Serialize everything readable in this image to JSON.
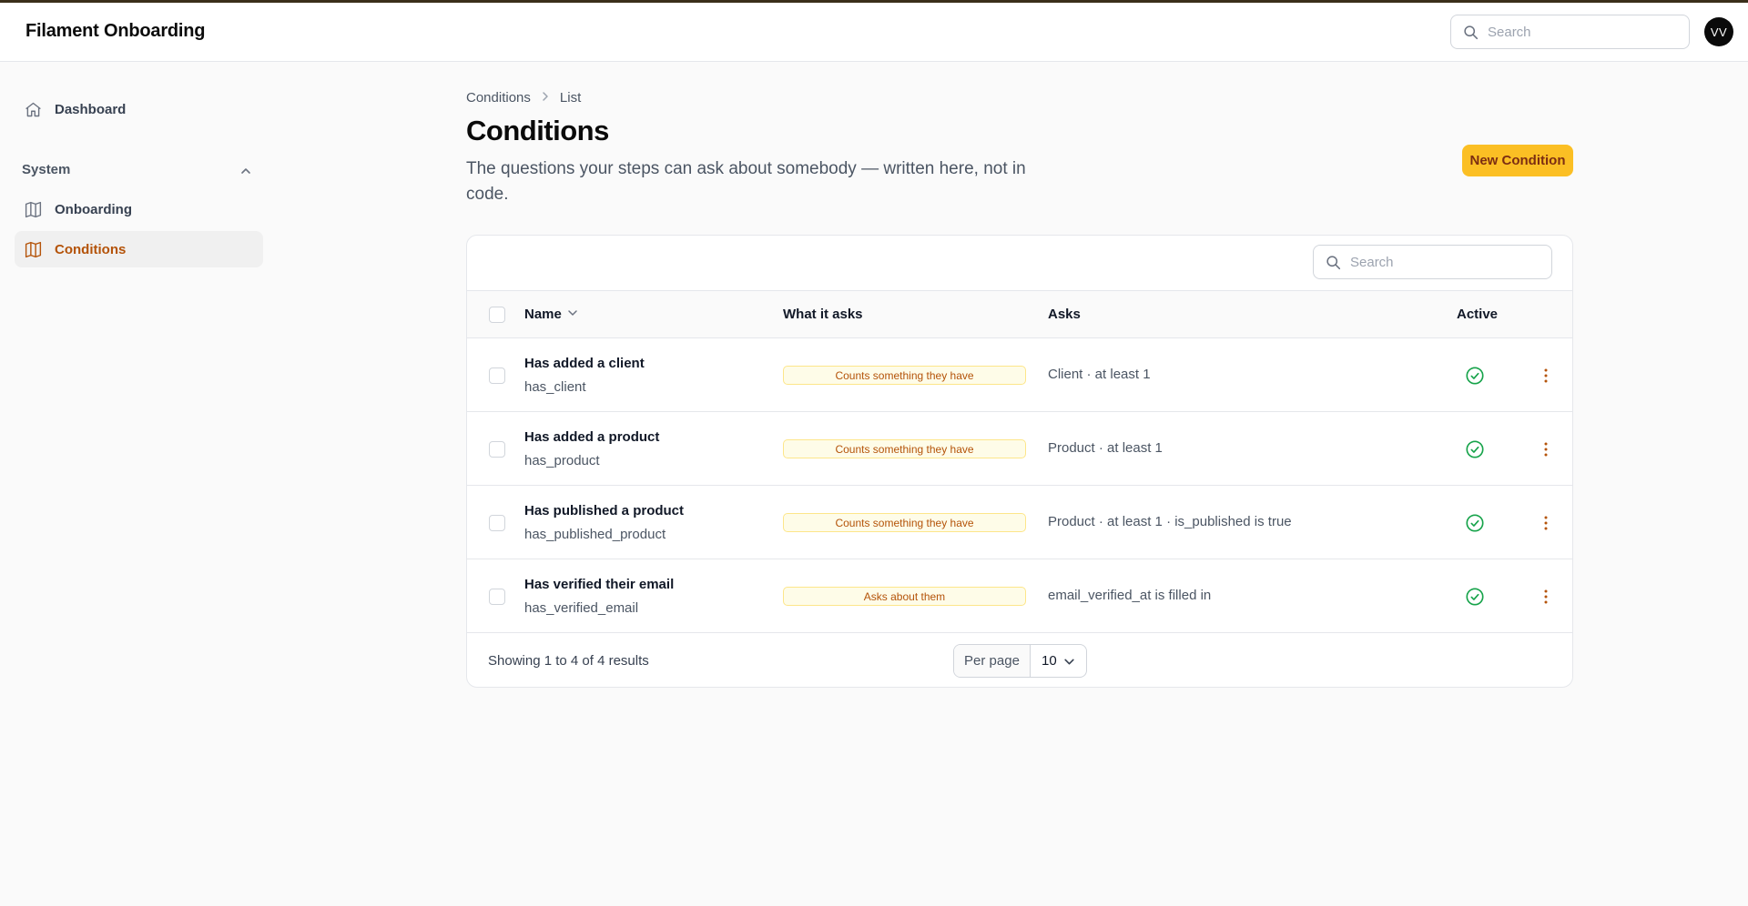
{
  "app": {
    "title": "Filament Onboarding"
  },
  "header": {
    "search_placeholder": "Search",
    "avatar_initials": "VV"
  },
  "sidebar": {
    "items": [
      {
        "label": "Dashboard",
        "icon": "home-icon"
      }
    ],
    "group": {
      "label": "System",
      "items": [
        {
          "label": "Onboarding",
          "icon": "map-icon"
        },
        {
          "label": "Conditions",
          "icon": "map-icon",
          "active": true
        }
      ]
    }
  },
  "page": {
    "breadcrumb": [
      "Conditions",
      "List"
    ],
    "title": "Conditions",
    "subtitle": "The questions your steps can ask about somebody — written here, not in code.",
    "new_button": "New Condition"
  },
  "table": {
    "search_placeholder": "Search",
    "columns": [
      "Name",
      "What it asks",
      "Asks",
      "Active"
    ],
    "rows": [
      {
        "name": "Has added a client",
        "key": "has_client",
        "kind": "Counts something they have",
        "asks": "Client · at least 1",
        "active": true
      },
      {
        "name": "Has added a product",
        "key": "has_product",
        "kind": "Counts something they have",
        "asks": "Product · at least 1",
        "active": true
      },
      {
        "name": "Has published a product",
        "key": "has_published_product",
        "kind": "Counts something they have",
        "asks": "Product · at least 1 · is_published is true",
        "active": true
      },
      {
        "name": "Has verified their email",
        "key": "has_verified_email",
        "kind": "Asks about them",
        "asks": "email_verified_at is filled in",
        "active": true
      }
    ],
    "footer": {
      "showing": "Showing 1 to 4 of 4 results",
      "per_page_label": "Per page",
      "per_page_value": "10"
    }
  },
  "colors": {
    "accent": "#fbbf24",
    "active_nav": "#b45309",
    "success": "#16a34a"
  }
}
